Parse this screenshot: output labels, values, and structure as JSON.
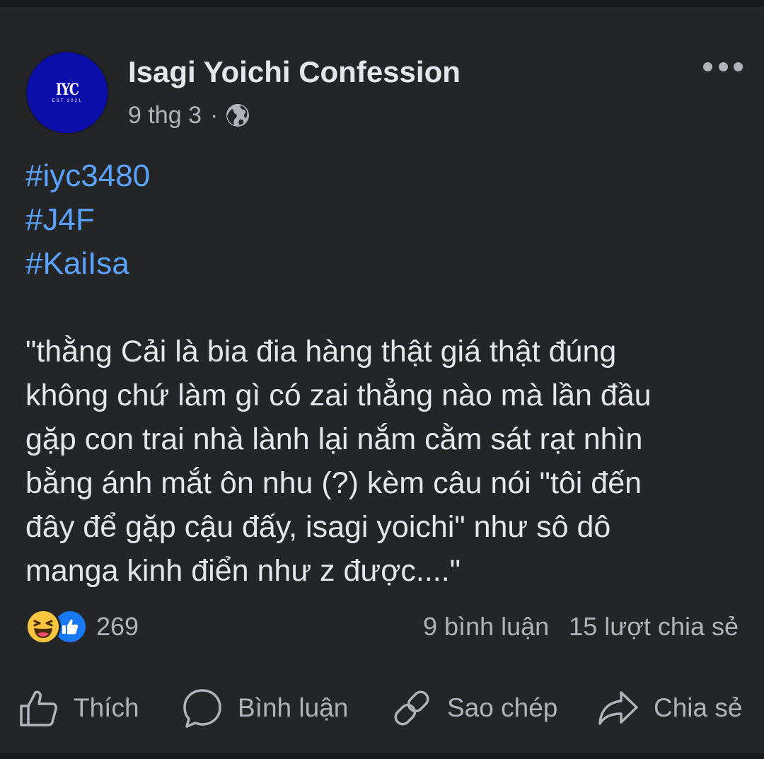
{
  "post": {
    "page_name": "Isagi Yoichi Confession",
    "avatar_text": "IYC",
    "avatar_subtext": "EST 2021",
    "date": "9 thg 3",
    "separator": "·",
    "privacy_icon": "globe-icon",
    "hashtags": [
      "#iyc3480",
      "#J4F",
      "#KaiIsa"
    ],
    "body": "\"thằng Cải là bia đia hàng thật giá thật đúng\nkhông chứ làm gì có zai thẳng nào mà lần đầu\ngặp con trai nhà lành lại nắm cằm sát rạt nhìn\nbằng ánh mắt ôn nhu (?) kèm câu nói \"tôi đến\nđây để gặp cậu đấy, isagi yoichi\" như sô dô\nmanga kinh điển như z được....\""
  },
  "stats": {
    "reaction_icons": [
      "haha-icon",
      "like-icon"
    ],
    "reaction_count": "269",
    "comments": "9 bình luận",
    "shares": "15 lượt chia sẻ"
  },
  "actions": {
    "like_label": "Thích",
    "comment_label": "Bình luận",
    "copy_label": "Sao chép",
    "share_label": "Chia sẻ"
  },
  "colors": {
    "background": "#242526",
    "text": "#e4e6eb",
    "secondary_text": "#b0b3b8",
    "hashtag": "#5aa2ff",
    "avatar_bg": "#0b0ea8",
    "like_blue": "#1877f2",
    "haha_yellow": "#f7c53f"
  }
}
